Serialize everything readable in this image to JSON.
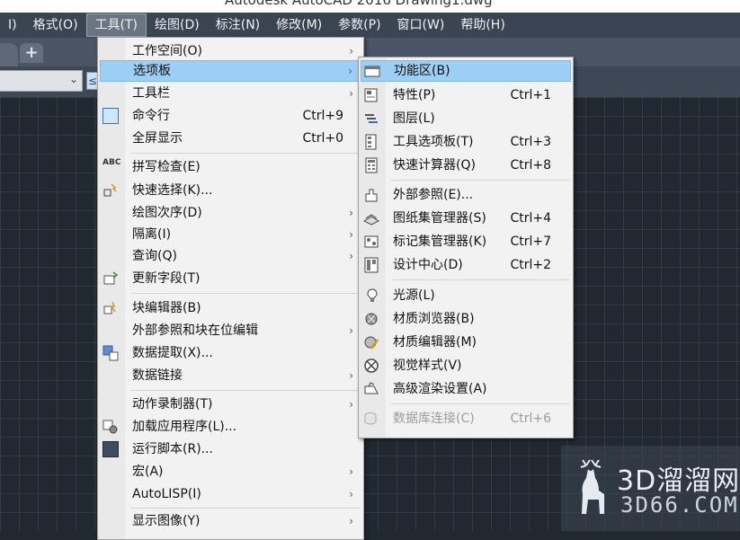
{
  "window": {
    "title": "Autodesk AutoCAD 2016    Drawing1.dwg"
  },
  "menubar": {
    "items": [
      {
        "label": "I)"
      },
      {
        "label": "格式(O)"
      },
      {
        "label": "工具(T)",
        "active": true
      },
      {
        "label": "绘图(D)"
      },
      {
        "label": "标注(N)"
      },
      {
        "label": "修改(M)"
      },
      {
        "label": "参数(P)"
      },
      {
        "label": "窗口(W)"
      },
      {
        "label": "帮助(H)"
      }
    ]
  },
  "tabstrip": {
    "add_icon": "plus-icon",
    "add_label": "+"
  },
  "toolbar": {
    "combo_arrow": "chevron-down-icon",
    "combo_arrow_glyph": "⌄",
    "icon_glyph": "≤"
  },
  "tools_menu": {
    "items": [
      {
        "label": "工作空间(O)",
        "submenu": true
      },
      {
        "label": "选项板",
        "submenu": true,
        "highlighted": true
      },
      {
        "label": "工具栏",
        "submenu": true
      },
      {
        "label": "命令行",
        "shortcut": "Ctrl+9",
        "icon": "command-line-icon"
      },
      {
        "label": "全屏显示",
        "shortcut": "Ctrl+0"
      },
      {
        "label": "拼写检查(E)",
        "icon": "spell-check-icon",
        "icon_text": "ABC"
      },
      {
        "label": "快速选择(K)...",
        "icon": "quick-select-icon"
      },
      {
        "label": "绘图次序(D)",
        "submenu": true
      },
      {
        "label": "隔离(I)",
        "submenu": true
      },
      {
        "label": "查询(Q)",
        "submenu": true
      },
      {
        "label": "更新字段(T)",
        "icon": "update-field-icon"
      },
      {
        "label": "块编辑器(B)",
        "icon": "block-editor-icon"
      },
      {
        "label": "外部参照和块在位编辑",
        "submenu": true
      },
      {
        "label": "数据提取(X)...",
        "icon": "data-extraction-icon"
      },
      {
        "label": "数据链接",
        "submenu": true
      },
      {
        "label": "动作录制器(T)",
        "submenu": true
      },
      {
        "label": "加载应用程序(L)...",
        "icon": "load-application-icon"
      },
      {
        "label": "运行脚本(R)...",
        "icon": "run-script-icon"
      },
      {
        "label": "宏(A)",
        "submenu": true
      },
      {
        "label": "AutoLISP(I)",
        "submenu": true
      },
      {
        "label": "显示图像(Y)",
        "submenu": true
      }
    ],
    "arrow_glyph": "›"
  },
  "palettes_submenu": {
    "items": [
      {
        "label": "功能区(B)",
        "icon": "ribbon-icon",
        "highlighted": true
      },
      {
        "label": "特性(P)",
        "shortcut": "Ctrl+1",
        "icon": "properties-icon"
      },
      {
        "label": "图层(L)",
        "icon": "layers-icon"
      },
      {
        "label": "工具选项板(T)",
        "shortcut": "Ctrl+3",
        "icon": "tool-palettes-icon"
      },
      {
        "label": "快速计算器(Q)",
        "shortcut": "Ctrl+8",
        "icon": "calculator-icon"
      },
      {
        "label": "外部参照(E)...",
        "icon": "external-reference-icon"
      },
      {
        "label": "图纸集管理器(S)",
        "shortcut": "Ctrl+4",
        "icon": "sheet-set-icon"
      },
      {
        "label": "标记集管理器(K)",
        "shortcut": "Ctrl+7",
        "icon": "markup-set-icon"
      },
      {
        "label": "设计中心(D)",
        "shortcut": "Ctrl+2",
        "icon": "design-center-icon"
      },
      {
        "label": "光源(L)",
        "icon": "lights-icon"
      },
      {
        "label": "材质浏览器(B)",
        "icon": "materials-browser-icon"
      },
      {
        "label": "材质编辑器(M)",
        "icon": "materials-editor-icon"
      },
      {
        "label": "视觉样式(V)",
        "icon": "visual-styles-icon"
      },
      {
        "label": "高级渲染设置(A)",
        "icon": "render-settings-icon"
      },
      {
        "label": "数据库连接(C)",
        "shortcut": "Ctrl+6",
        "icon": "database-connect-icon",
        "disabled": true
      }
    ]
  },
  "watermark": {
    "title": "3D溜溜网",
    "subtitle": "3D66.COM"
  },
  "colors": {
    "menubar_bg": "#3b4453",
    "menu_bg": "#f2f2f2",
    "highlight": "#9dcff5",
    "canvas_bg": "#212830"
  }
}
